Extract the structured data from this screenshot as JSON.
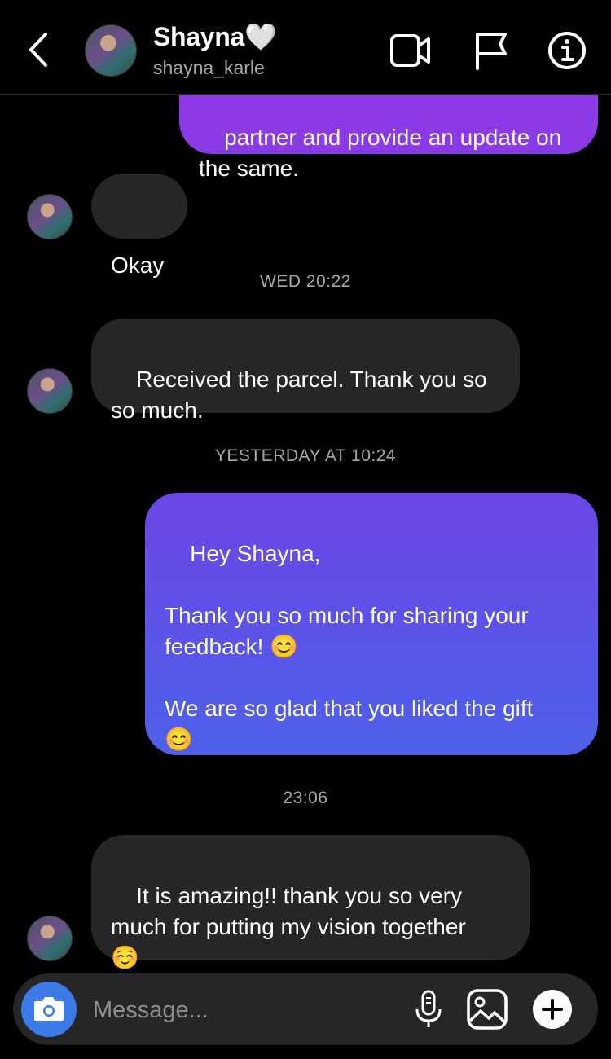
{
  "header": {
    "name": "Shayna🤍",
    "username": "shayna_karle"
  },
  "messages": {
    "partial_out": "partner and provide an update on\nthe same.",
    "okay": "Okay",
    "ts_wed": "WED 20:22",
    "parcel": "Received the parcel. Thank you so\nso much.",
    "ts_yesterday": "YESTERDAY AT 10:24",
    "hey": "Hey Shayna,\n\nThank you so much for sharing your\nfeedback! 😊\n\nWe are so glad that you liked the gift\n😊",
    "ts_2306": "23:06",
    "amazing": "It is amazing!! thank you so very\nmuch for putting my vision together\n☺️"
  },
  "composer": {
    "placeholder": "Message..."
  },
  "icons": {
    "back": "chevron-left-icon",
    "video": "video-camera-icon",
    "flag": "flag-icon",
    "info": "info-icon",
    "camera": "camera-icon",
    "mic": "microphone-icon",
    "gallery": "image-icon",
    "plus": "plus-icon"
  },
  "colors": {
    "background": "#000000",
    "incoming_bubble": "#262626",
    "outgoing_top": "#8a3ae6",
    "outgoing_bottom": "#4f60ea",
    "camera_button": "#3d7be8",
    "secondary_text": "#a8a8a8"
  }
}
